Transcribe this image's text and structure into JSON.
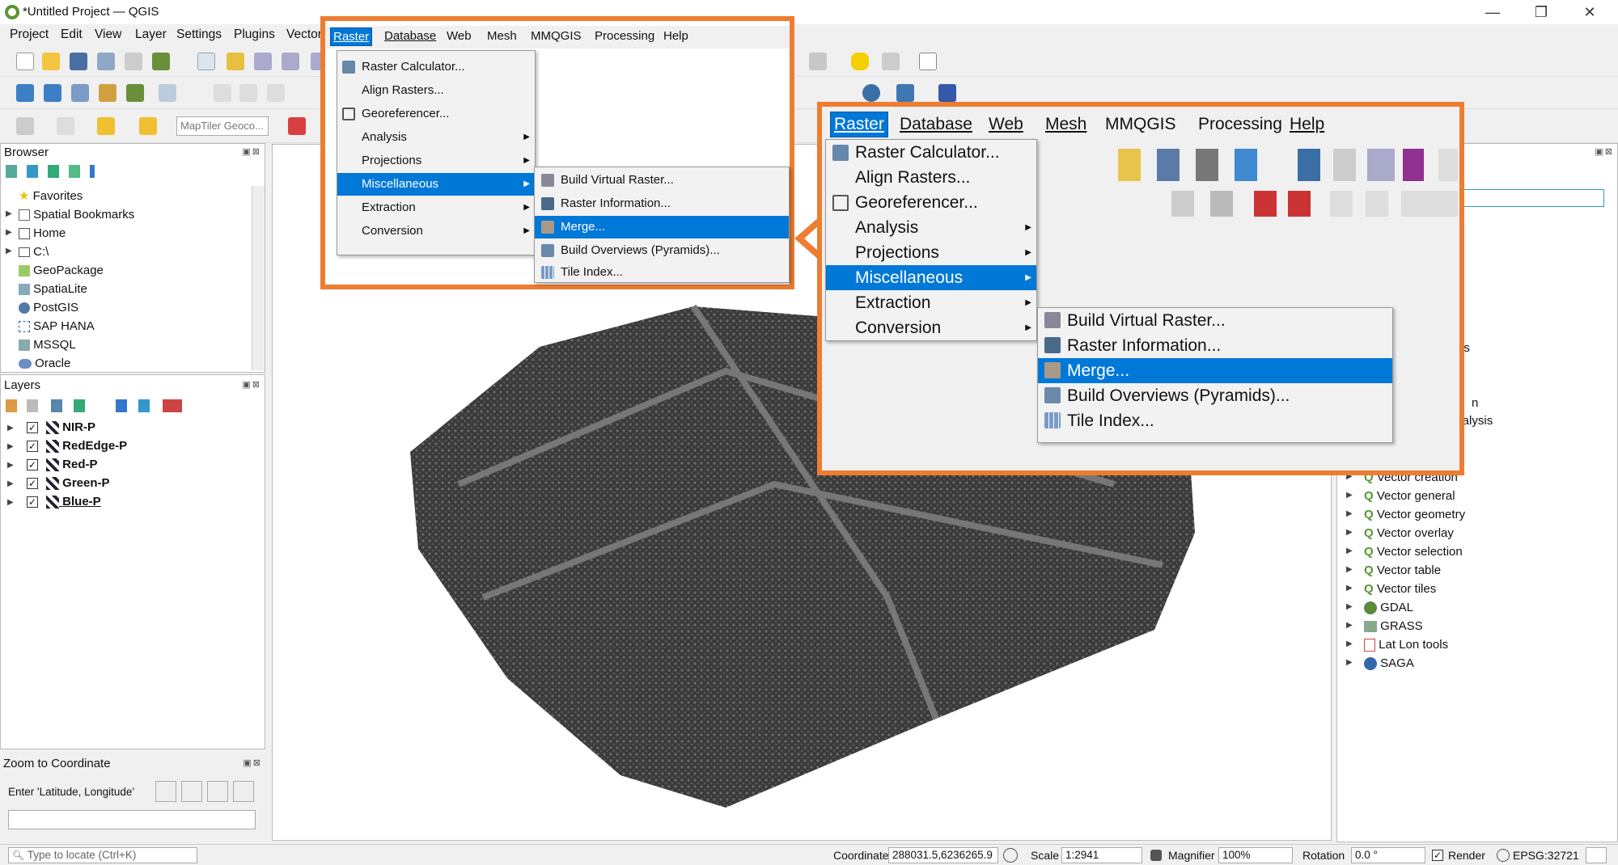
{
  "window": {
    "title": "*Untitled Project — QGIS",
    "minimize": "—",
    "restore": "❐",
    "close": "✕"
  },
  "menubar": [
    "Project",
    "Edit",
    "View",
    "Layer",
    "Settings",
    "Plugins",
    "Vector",
    "Raster",
    "Database",
    "Web",
    "Mesh",
    "MMQGIS",
    "Processing",
    "Help"
  ],
  "toolbar": {
    "geocoder_placeholder": "MapTiler Geoco..."
  },
  "browser": {
    "title": "Browser",
    "items": [
      "Favorites",
      "Spatial Bookmarks",
      "Home",
      "C:\\",
      "GeoPackage",
      "SpatiaLite",
      "PostGIS",
      "SAP HANA",
      "MSSQL",
      "Oracle"
    ]
  },
  "layers": {
    "title": "Layers",
    "items": [
      "NIR-P",
      "RedEdge-P",
      "Red-P",
      "Green-P",
      "Blue-P"
    ]
  },
  "zoom": {
    "title": "Zoom to Coordinate",
    "prompt": "Enter 'Latitude, Longitude'",
    "value": ""
  },
  "locator": {
    "placeholder": "Type to locate (Ctrl+K)"
  },
  "processing": {
    "partial": [
      "ysis",
      "n",
      "analysis"
    ],
    "items": [
      "Vector creation",
      "Vector general",
      "Vector geometry",
      "Vector overlay",
      "Vector selection",
      "Vector table",
      "Vector tiles",
      "GDAL",
      "GRASS",
      "Lat Lon tools",
      "SAGA"
    ]
  },
  "raster_menu": {
    "items": [
      "Raster Calculator...",
      "Align Rasters...",
      "Georeferencer...",
      "Analysis",
      "Projections",
      "Miscellaneous",
      "Extraction",
      "Conversion"
    ],
    "misc_items": [
      "Build Virtual Raster...",
      "Raster Information...",
      "Merge...",
      "Build Overviews (Pyramids)...",
      "Tile Index..."
    ]
  },
  "zoom_menubar": [
    "Raster",
    "Database",
    "Web",
    "Mesh",
    "MMQGIS",
    "Processing",
    "Help"
  ],
  "status": {
    "coordinate_label": "Coordinate",
    "coordinate": "288031.5,6236265.9",
    "scale_label": "Scale",
    "scale": "1:2941",
    "magnifier_label": "Magnifier",
    "magnifier": "100%",
    "rotation_label": "Rotation",
    "rotation": "0.0 °",
    "render_label": "Render",
    "crs": "EPSG:32721"
  },
  "colors": {
    "highlight": "#0078d7",
    "callout": "#ed7d31",
    "qgis_green": "#589632"
  }
}
